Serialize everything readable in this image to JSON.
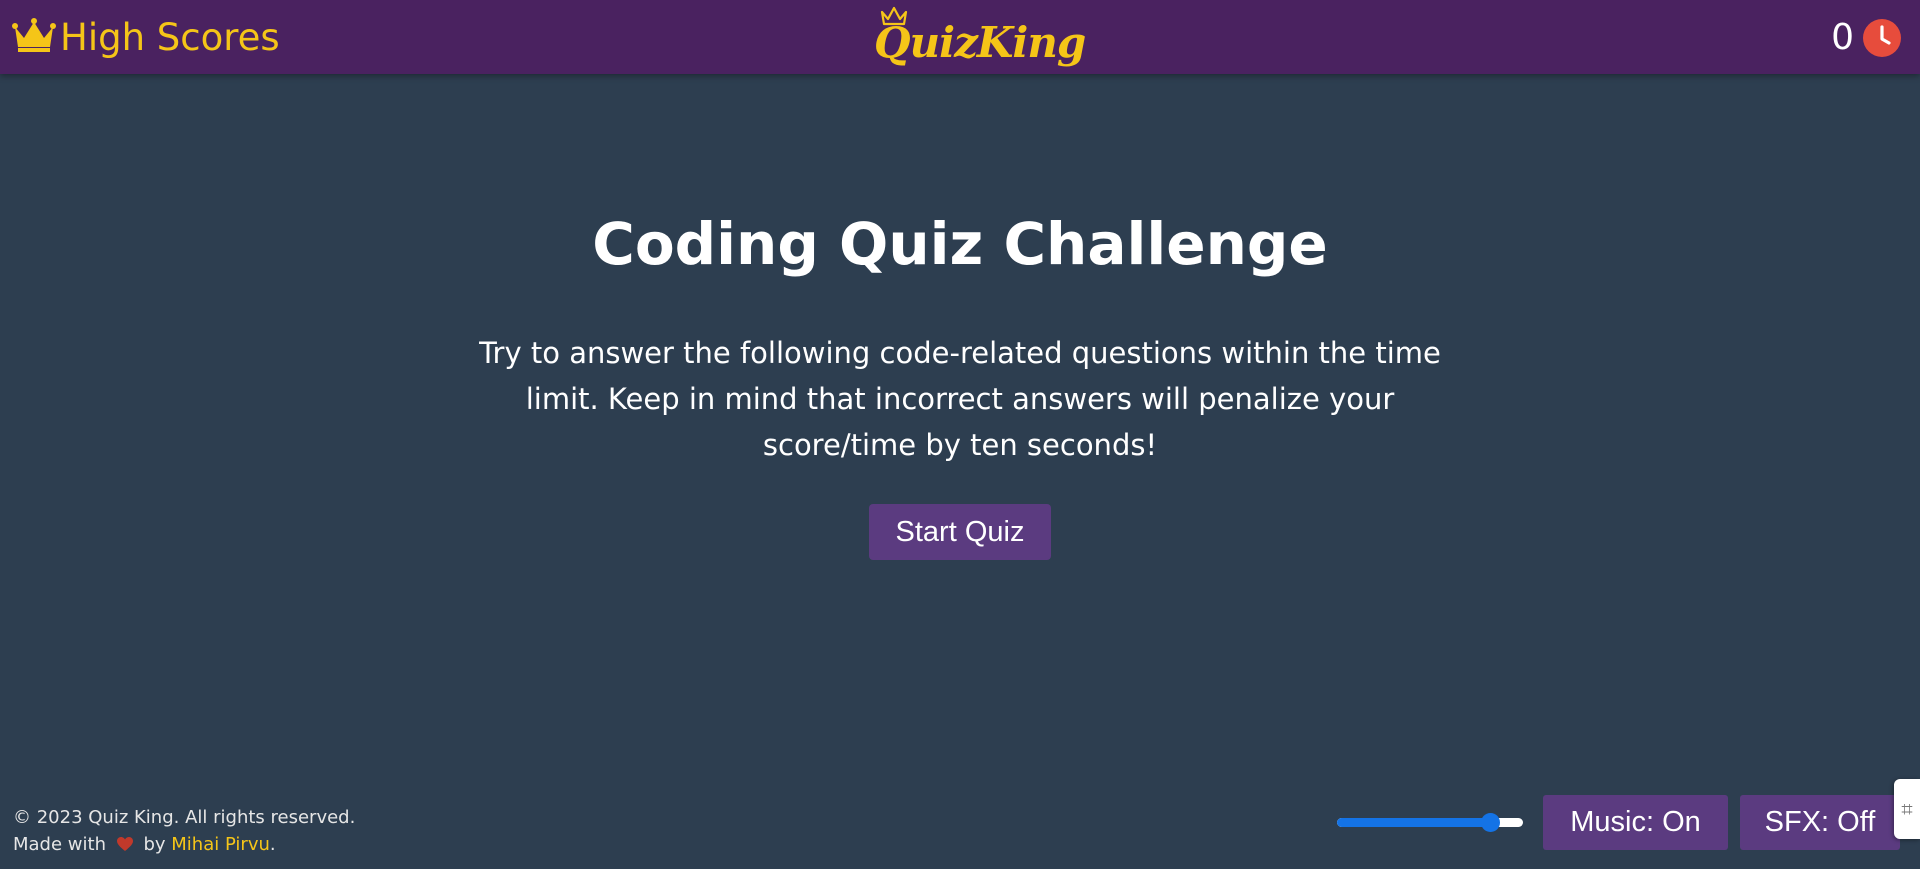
{
  "header": {
    "high_scores_label": "High Scores",
    "logo_text": "QuizKing",
    "timer_value": "0",
    "icons": {
      "high_scores": "crown-icon",
      "logo": "crown-icon",
      "timer": "clock-icon"
    }
  },
  "main": {
    "title": "Coding Quiz Challenge",
    "description": "Try to answer the following code-related questions within the time limit. Keep in mind that incorrect answers will penalize your score/time by ten seconds!",
    "start_button": "Start Quiz"
  },
  "footer": {
    "copyright": "© 2023 Quiz King. All rights reserved.",
    "made_with": "Made with",
    "by": "by",
    "author": "Mihai Pirvu",
    "period": "."
  },
  "controls": {
    "volume_level": 0.86,
    "music_button": "Music: On",
    "sfx_button": "SFX: Off"
  },
  "side_handle": {
    "glyph": "⌗"
  },
  "colors": {
    "background": "#2d3e50",
    "header": "#4a2260",
    "accent_gold": "#f5c518",
    "button": "#5b3b80",
    "timer_icon": "#e74c3c",
    "heart": "#c0392b",
    "slider": "#1473e6"
  }
}
